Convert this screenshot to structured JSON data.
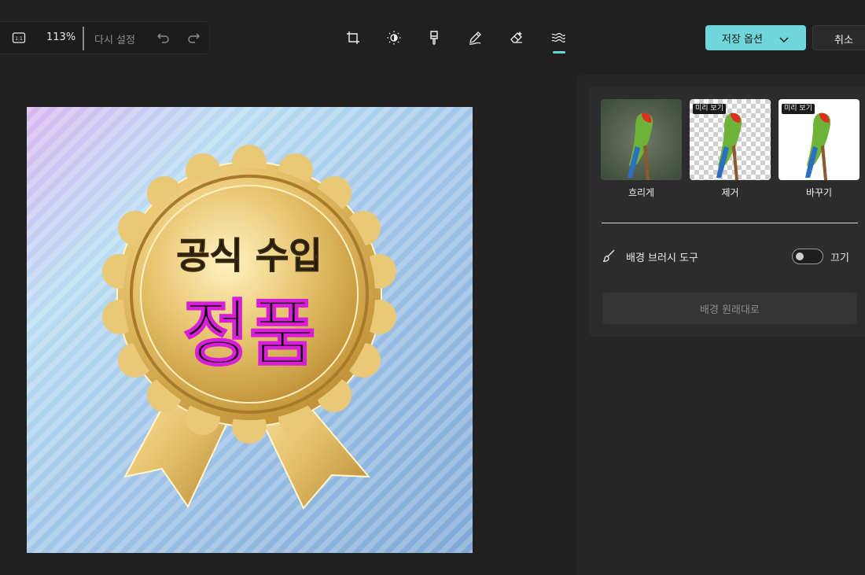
{
  "toolbar": {
    "zoom": "113%",
    "reset_label": "다시 설정",
    "tools": [
      "crop-icon",
      "brightness-icon",
      "filter-icon",
      "markup-icon",
      "erase-icon",
      "background-icon"
    ],
    "active_tool": "background-icon",
    "save_label": "저장 옵션",
    "cancel_label": "취소"
  },
  "canvas": {
    "badge_line1": "공식 수입",
    "badge_line2": "정품"
  },
  "panel": {
    "options": [
      {
        "label": "흐리게",
        "preview": ""
      },
      {
        "label": "제거",
        "preview": "미리 보기"
      },
      {
        "label": "바꾸기",
        "preview": "미리 보기"
      }
    ],
    "brush_label": "배경 브러시 도구",
    "toggle_label": "끄기",
    "toggle_on": false,
    "restore_label": "배경 원래대로"
  },
  "colors": {
    "accent": "#6fd6dc",
    "background": "#202020",
    "panel": "#2c2c2c"
  }
}
